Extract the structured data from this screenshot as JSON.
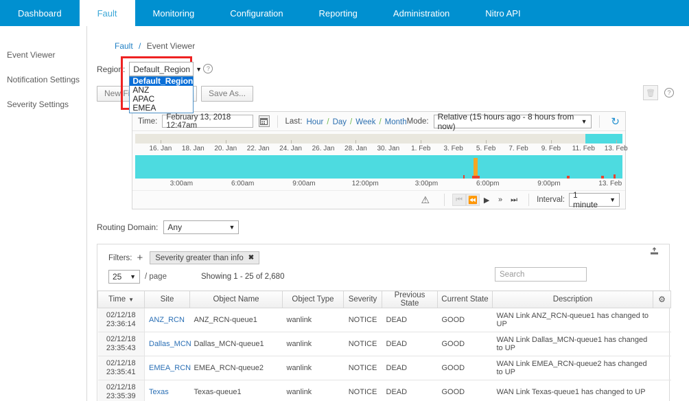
{
  "topnav": {
    "items": [
      {
        "label": "Dashboard",
        "active": false
      },
      {
        "label": "Fault",
        "active": true
      },
      {
        "label": "Monitoring",
        "active": false
      },
      {
        "label": "Configuration",
        "active": false
      },
      {
        "label": "Reporting",
        "active": false
      },
      {
        "label": "Administration",
        "active": false
      },
      {
        "label": "Nitro API",
        "active": false
      }
    ]
  },
  "sidebar": {
    "items": [
      {
        "label": "Event Viewer"
      },
      {
        "label": "Notification Settings"
      },
      {
        "label": "Severity Settings"
      }
    ]
  },
  "breadcrumb": {
    "parent": "Fault",
    "separator": "/",
    "current": "Event Viewer"
  },
  "region": {
    "label": "Region:",
    "selected": "Default_Region",
    "caret": "▼",
    "options": [
      "Default_Region",
      "ANZ",
      "APAC",
      "EMEA"
    ],
    "help_icon": "?",
    "highlight_color": "#ee2222"
  },
  "filter_buttons": {
    "new_filter": "New Filter",
    "save": "Save",
    "save_as": "Save As...",
    "delete_icon": "trash-icon",
    "help_icon": "?"
  },
  "time_panel": {
    "time_label": "Time:",
    "time_value": "February 13, 2018 12:47am",
    "calendar_icon": "calendar-icon",
    "last_label": "Last:",
    "quick_ranges": [
      "Hour",
      "Day",
      "Week",
      "Month"
    ],
    "quick_sep": "/",
    "mode_label": "Mode:",
    "mode_value": "Relative (15 hours ago - 8 hours from now)",
    "mode_caret": "▼",
    "refresh_icon": "refresh-icon",
    "overview_ticks": [
      "16. Jan",
      "18. Jan",
      "20. Jan",
      "22. Jan",
      "24. Jan",
      "26. Jan",
      "28. Jan",
      "30. Jan",
      "1. Feb",
      "3. Feb",
      "5. Feb",
      "7. Feb",
      "9. Feb",
      "11. Feb",
      "13. Feb"
    ],
    "main_ticks": [
      "3:00am",
      "6:00am",
      "9:00am",
      "12:00pm",
      "3:00pm",
      "6:00pm",
      "9:00pm",
      "13. Feb"
    ],
    "band_color": "#4ddbe0",
    "event_color": "#f5a623",
    "alert_color": "#e8422e",
    "warning_icon": "warning-icon",
    "playback": {
      "first": "⏮",
      "prev": "⏪",
      "play": "▶",
      "forward": "»",
      "last": "⏭"
    },
    "interval_label": "Interval:",
    "interval_value": "1 minute",
    "interval_caret": "▼"
  },
  "routing_domain": {
    "label": "Routing Domain:",
    "value": "Any",
    "caret": "▼"
  },
  "table_card": {
    "filters_label": "Filters:",
    "add_filter": "+",
    "active_filter": "Severity greater than info",
    "filter_remove": "✖",
    "export_icon": "export-icon",
    "per_page_value": "25",
    "per_page_caret": "▼",
    "per_page_suffix": "/ page",
    "showing": "Showing 1 - 25 of 2,680",
    "search_placeholder": "Search",
    "search_value": "",
    "settings_icon": "gear-icon",
    "columns": [
      {
        "label": "Time",
        "sort": "▼"
      },
      {
        "label": "Site",
        "sort": ""
      },
      {
        "label": "Object Name",
        "sort": ""
      },
      {
        "label": "Object Type",
        "sort": ""
      },
      {
        "label": "Severity",
        "sort": ""
      },
      {
        "label": "Previous State",
        "sort": ""
      },
      {
        "label": "Current State",
        "sort": ""
      },
      {
        "label": "Description",
        "sort": ""
      }
    ],
    "rows": [
      {
        "date": "02/12/18",
        "time": "23:36:14",
        "site": "ANZ_RCN",
        "object_name": "ANZ_RCN-queue1",
        "object_type": "wanlink",
        "severity": "NOTICE",
        "previous_state": "DEAD",
        "current_state": "GOOD",
        "description": "WAN Link ANZ_RCN-queue1 has changed to UP"
      },
      {
        "date": "02/12/18",
        "time": "23:35:43",
        "site": "Dallas_MCN",
        "object_name": "Dallas_MCN-queue1",
        "object_type": "wanlink",
        "severity": "NOTICE",
        "previous_state": "DEAD",
        "current_state": "GOOD",
        "description": "WAN Link Dallas_MCN-queue1 has changed to UP"
      },
      {
        "date": "02/12/18",
        "time": "23:35:41",
        "site": "EMEA_RCN",
        "object_name": "EMEA_RCN-queue2",
        "object_type": "wanlink",
        "severity": "NOTICE",
        "previous_state": "DEAD",
        "current_state": "GOOD",
        "description": "WAN Link EMEA_RCN-queue2 has changed to UP"
      },
      {
        "date": "02/12/18",
        "time": "23:35:39",
        "site": "Texas",
        "object_name": "Texas-queue1",
        "object_type": "wanlink",
        "severity": "NOTICE",
        "previous_state": "DEAD",
        "current_state": "GOOD",
        "description": "WAN Link Texas-queue1 has changed to UP"
      }
    ]
  }
}
